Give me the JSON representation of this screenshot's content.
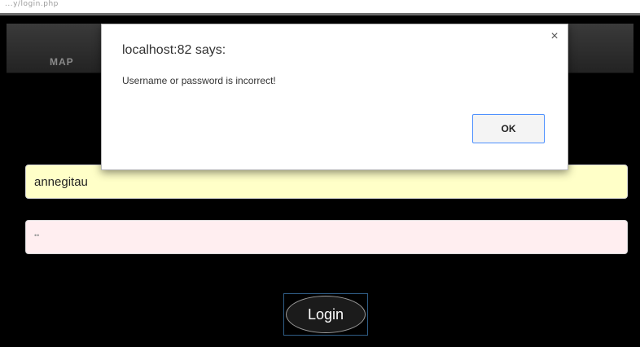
{
  "browser": {
    "url_fragment": "...y/login.php"
  },
  "nav": {
    "item_label": "MAP"
  },
  "form": {
    "username_value": "annegitau",
    "password_value": "••",
    "login_label": "Login"
  },
  "alert": {
    "title": "localhost:82 says:",
    "message": "Username or password is incorrect!",
    "ok_label": "OK",
    "close_glyph": "×"
  },
  "colors": {
    "page_background": "#000000",
    "username_field_bg": "#ffffc8",
    "password_field_bg": "#ffeef0",
    "ok_focus_border": "#4d90fe"
  }
}
